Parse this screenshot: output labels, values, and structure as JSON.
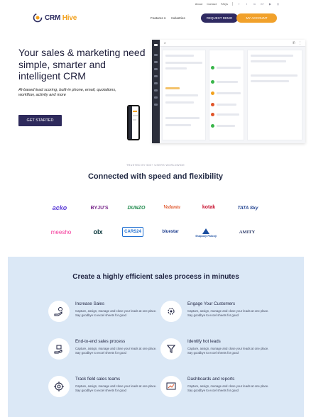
{
  "utility_bar": {
    "links": [
      "About",
      "Contact",
      "FAQs"
    ],
    "social_icons": [
      "facebook-icon",
      "twitter-icon",
      "linkedin-icon",
      "google-plus-icon",
      "youtube-icon",
      "instagram-icon"
    ]
  },
  "header": {
    "logo_crm": "CRM",
    "logo_hive": "Hive",
    "nav": [
      {
        "label": "Features ▾"
      },
      {
        "label": "Industries"
      }
    ],
    "request_demo": "REQUEST DEMO",
    "my_account": "MY ACCOUNT"
  },
  "hero": {
    "title": "Your sales & marketing need simple, smarter and intelligent CRM",
    "subtitle": "AI-based lead scoring, built-in phone, email, quotations, workflow, activity and more",
    "cta": "GET STARTED"
  },
  "trusted": {
    "caption": "TRUSTED BY 500+ USERS WORLDWIDE",
    "headline": "Connected with speed and flexibility"
  },
  "clients": [
    {
      "name": "acko",
      "color": "#5b3bd6"
    },
    {
      "name": "BYJU'S",
      "color": "#7a2a8c"
    },
    {
      "name": "DUNZO",
      "color": "#1f8a4c"
    },
    {
      "name": "Vedantu",
      "color": "#e0552a"
    },
    {
      "name": "kotak",
      "color": "#c8102e"
    },
    {
      "name": "TATA Sky",
      "color": "#1a3c8c"
    },
    {
      "name": "meesho",
      "color": "#f43397"
    },
    {
      "name": "olx",
      "color": "#002f34"
    },
    {
      "name": "CARS24",
      "color": "#1f6fd1"
    },
    {
      "name": "bluestar",
      "color": "#1a3a8c"
    },
    {
      "name": "Shapoorji Pallonji",
      "color": "#1c4fa0"
    },
    {
      "name": "AMITY",
      "color": "#1b2a5c"
    }
  ],
  "process": {
    "title": "Create a highly efficient sales process in minutes",
    "features": [
      {
        "title": "Increase Sales",
        "desc": "Capture, assign, manage and close your leads at one place. Say goodbye to excel sheets for good"
      },
      {
        "title": "Engage Your Customers",
        "desc": "Capture, assign, manage and close your leads at one place. Say goodbye to excel sheets for good"
      },
      {
        "title": "End-to-end sales process",
        "desc": "Capture, assign, manage and close your leads at one place. Say goodbye to excel sheets for good"
      },
      {
        "title": "Identify hot leads",
        "desc": "Capture, assign, manage and close your leads at one place. Say goodbye to excel sheets for good"
      },
      {
        "title": "Track field sales teams",
        "desc": "Capture, assign, manage and close your leads at one place. Say goodbye to excel sheets for good"
      },
      {
        "title": "Dashboards and reports",
        "desc": "Capture, assign, manage and close your leads at one place. Say goodbye to excel sheets for good"
      }
    ]
  }
}
